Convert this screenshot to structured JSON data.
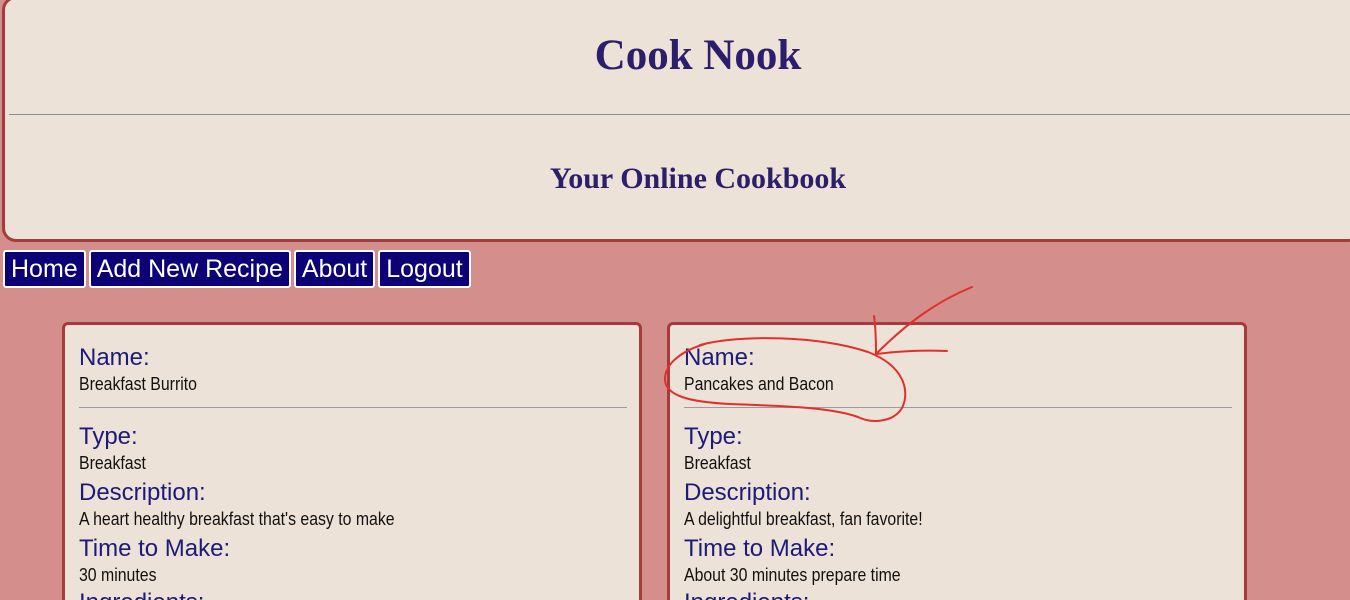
{
  "header": {
    "title": "Cook Nook",
    "subtitle": "Your Online Cookbook"
  },
  "nav": {
    "items": [
      {
        "label": "Home"
      },
      {
        "label": "Add New Recipe"
      },
      {
        "label": "About"
      },
      {
        "label": "Logout"
      }
    ]
  },
  "recipes": [
    {
      "name_label": "Name:",
      "name": "Breakfast Burrito",
      "type_label": "Type:",
      "type": "Breakfast",
      "description_label": "Description:",
      "description": "A heart healthy breakfast that's easy to make",
      "time_label": "Time to Make:",
      "time": "30 minutes",
      "ingredients_label": "Ingredients:"
    },
    {
      "name_label": "Name:",
      "name": "Pancakes and Bacon",
      "type_label": "Type:",
      "type": "Breakfast",
      "description_label": "Description:",
      "description": "A delightful breakfast, fan favorite!",
      "time_label": "Time to Make:",
      "time": "About 30 minutes prepare time",
      "ingredients_label": "Ingredients:"
    }
  ],
  "colors": {
    "page_background": "#d48e8c",
    "panel_background": "#ede2d7",
    "border": "#a63b3b",
    "title_text": "#2b1e6b",
    "nav_button": "#0b0075",
    "label_text": "#1c1b7a",
    "annotation": "#e0302c"
  }
}
